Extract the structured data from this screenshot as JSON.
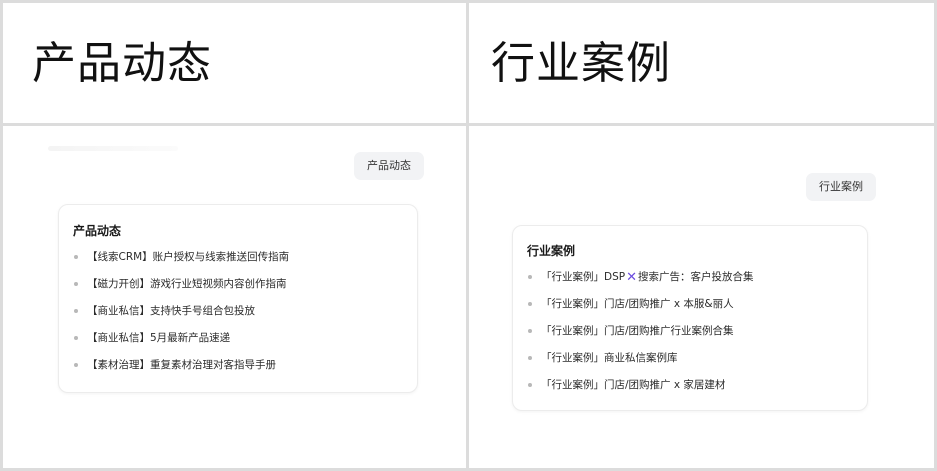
{
  "columns": {
    "left": {
      "heading": "产品动态"
    },
    "right": {
      "heading": "行业案例"
    }
  },
  "left_panel": {
    "chip": "产品动态",
    "card": {
      "title": "产品动态",
      "items": [
        {
          "text": "【线索CRM】账户授权与线索推送回传指南"
        },
        {
          "text": "【磁力开创】游戏行业短视频内容创作指南"
        },
        {
          "text": "【商业私信】支持快手号组合包投放"
        },
        {
          "text": "【商业私信】5月最新产品速递"
        },
        {
          "text": "【素材治理】重复素材治理对客指导手册"
        }
      ]
    }
  },
  "right_panel": {
    "chip": "行业案例",
    "card": {
      "title": "行业案例",
      "items": [
        {
          "before": "「行业案例」DSP",
          "icon": "purple-x-icon",
          "icon_glyph": "✕",
          "after": "搜索广告：客户投放合集"
        },
        {
          "text": "「行业案例」门店/团购推广 x 本服&丽人"
        },
        {
          "text": "「行业案例」门店/团购推广行业案例合集"
        },
        {
          "text": "「行业案例」商业私信案例库"
        },
        {
          "text": "「行业案例」门店/团购推广 x 家居建材"
        }
      ]
    }
  },
  "colors": {
    "border": "#dcdcdc",
    "chip_bg": "#f2f3f5",
    "accent_x": "#6b4cdf"
  }
}
